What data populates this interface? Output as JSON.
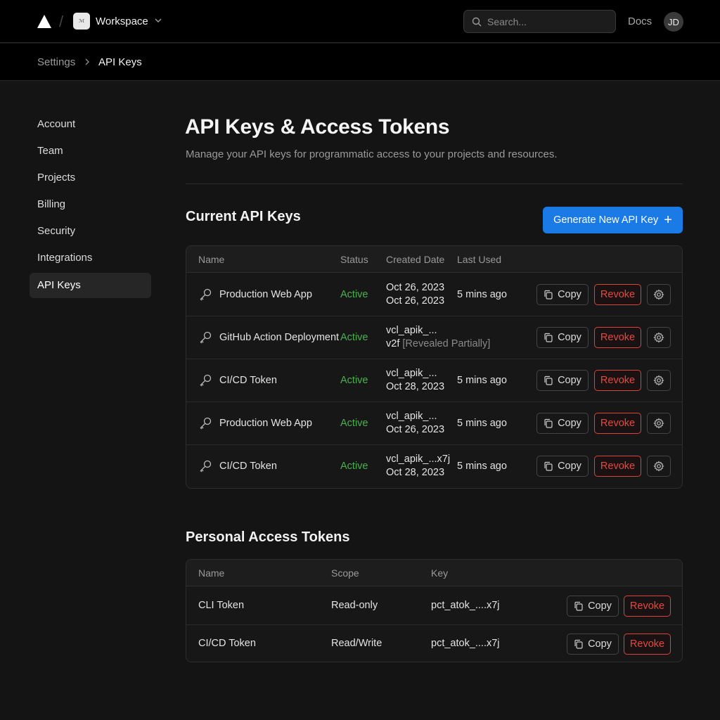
{
  "header": {
    "workspace_name": "Workspace",
    "workspace_avatar_text": "ℳ",
    "search_placeholder": "Search...",
    "docs_label": "Docs",
    "user_initials": "JD"
  },
  "breadcrumb": {
    "parent": "Settings",
    "current": "API Keys"
  },
  "sidebar": {
    "items": [
      {
        "label": "Account"
      },
      {
        "label": "Team"
      },
      {
        "label": "Projects"
      },
      {
        "label": "Billing"
      },
      {
        "label": "Security"
      },
      {
        "label": "Integrations"
      },
      {
        "label": "API Keys"
      }
    ]
  },
  "page": {
    "title": "API Keys & Access Tokens",
    "subtitle": "Manage your API keys for programmatic access to your projects and resources."
  },
  "api_keys": {
    "section_title": "Current API Keys",
    "generate_label": "Generate New API Key",
    "columns": {
      "name": "Name",
      "status": "Status",
      "created": "Created Date",
      "last_used": "Last Used"
    },
    "rows": [
      {
        "name": "Production Web App",
        "status": "Active",
        "line1": "Oct 26, 2023",
        "line2": "Oct 26, 2023",
        "line2_note": "",
        "last_used": "5 mins ago"
      },
      {
        "name": "GitHub Action Deployment",
        "status": "Active",
        "line1": "vcl_apik_...",
        "line2": "v2f",
        "line2_note": "[Revealed Partially]",
        "last_used": ""
      },
      {
        "name": "CI/CD Token",
        "status": "Active",
        "line1": "vcl_apik_...",
        "line2": "Oct 28, 2023",
        "line2_note": "",
        "last_used": "5 mins ago"
      },
      {
        "name": "Production Web App",
        "status": "Active",
        "line1": "vcl_apik_...",
        "line2": "Oct 26, 2023",
        "line2_note": "",
        "last_used": "5 mins ago"
      },
      {
        "name": "CI/CD Token",
        "status": "Active",
        "line1": "vcl_apik_...x7j",
        "line2": "Oct 28, 2023",
        "line2_note": "",
        "last_used": "5 mins ago"
      }
    ],
    "copy_label": "Copy",
    "revoke_label": "Revoke"
  },
  "tokens": {
    "section_title": "Personal Access Tokens",
    "columns": {
      "name": "Name",
      "scope": "Scope",
      "key": "Key"
    },
    "rows": [
      {
        "name": "CLI Token",
        "scope": "Read-only",
        "key": "pct_atok_....x7j"
      },
      {
        "name": "CI/CD Token",
        "scope": "Read/Write",
        "key": "pct_atok_....x7j"
      }
    ],
    "copy_label": "Copy",
    "revoke_label": "Revoke"
  },
  "colors": {
    "accent": "#1a7ae6",
    "active": "#4caf50",
    "danger": "#e5483e"
  }
}
